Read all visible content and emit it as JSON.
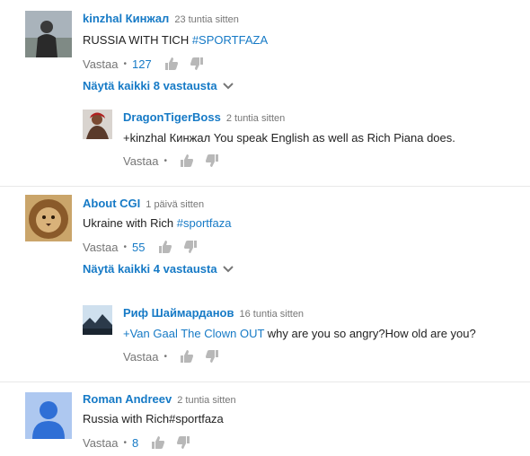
{
  "comments": [
    {
      "author": "kinzhal Кинжал",
      "time": "23 tuntia sitten",
      "text": "RUSSIA WITH TICH ",
      "hashtag": "#SPORTFAZA",
      "reply_label": "Vastaa",
      "likes": "127",
      "view_replies": "Näytä kaikki 8 vastausta",
      "avatar_icon": "person-photo-avatar",
      "reply": {
        "author": "DragonTigerBoss",
        "time": "2 tuntia sitten",
        "text": "+kinzhal Кинжал You speak English as well as Rich Piana does.",
        "reply_label": "Vastaa"
      }
    },
    {
      "author": "About CGI",
      "time": "1 päivä sitten",
      "text": "Ukraine with Rich ",
      "hashtag": "#sportfaza",
      "reply_label": "Vastaa",
      "likes": "55",
      "view_replies": "Näytä kaikki 4 vastausta",
      "avatar_icon": "lion-avatar",
      "reply": {
        "author": "Риф Шаймарданов",
        "time": "16 tuntia sitten",
        "mention": "+Van Gaal The Clown OUT",
        "text": " why are you so angry?How old are you?",
        "reply_label": "Vastaa"
      }
    },
    {
      "author": "Roman Andreev",
      "time": "2 tuntia sitten",
      "text": "Russia with Rich#sportfaza",
      "reply_label": "Vastaa",
      "likes": "8",
      "avatar_icon": "default-user-avatar"
    }
  ],
  "colors": {
    "link": "#167ac6",
    "meta": "#767676",
    "text": "#222222",
    "icon": "#b8b8b8"
  }
}
